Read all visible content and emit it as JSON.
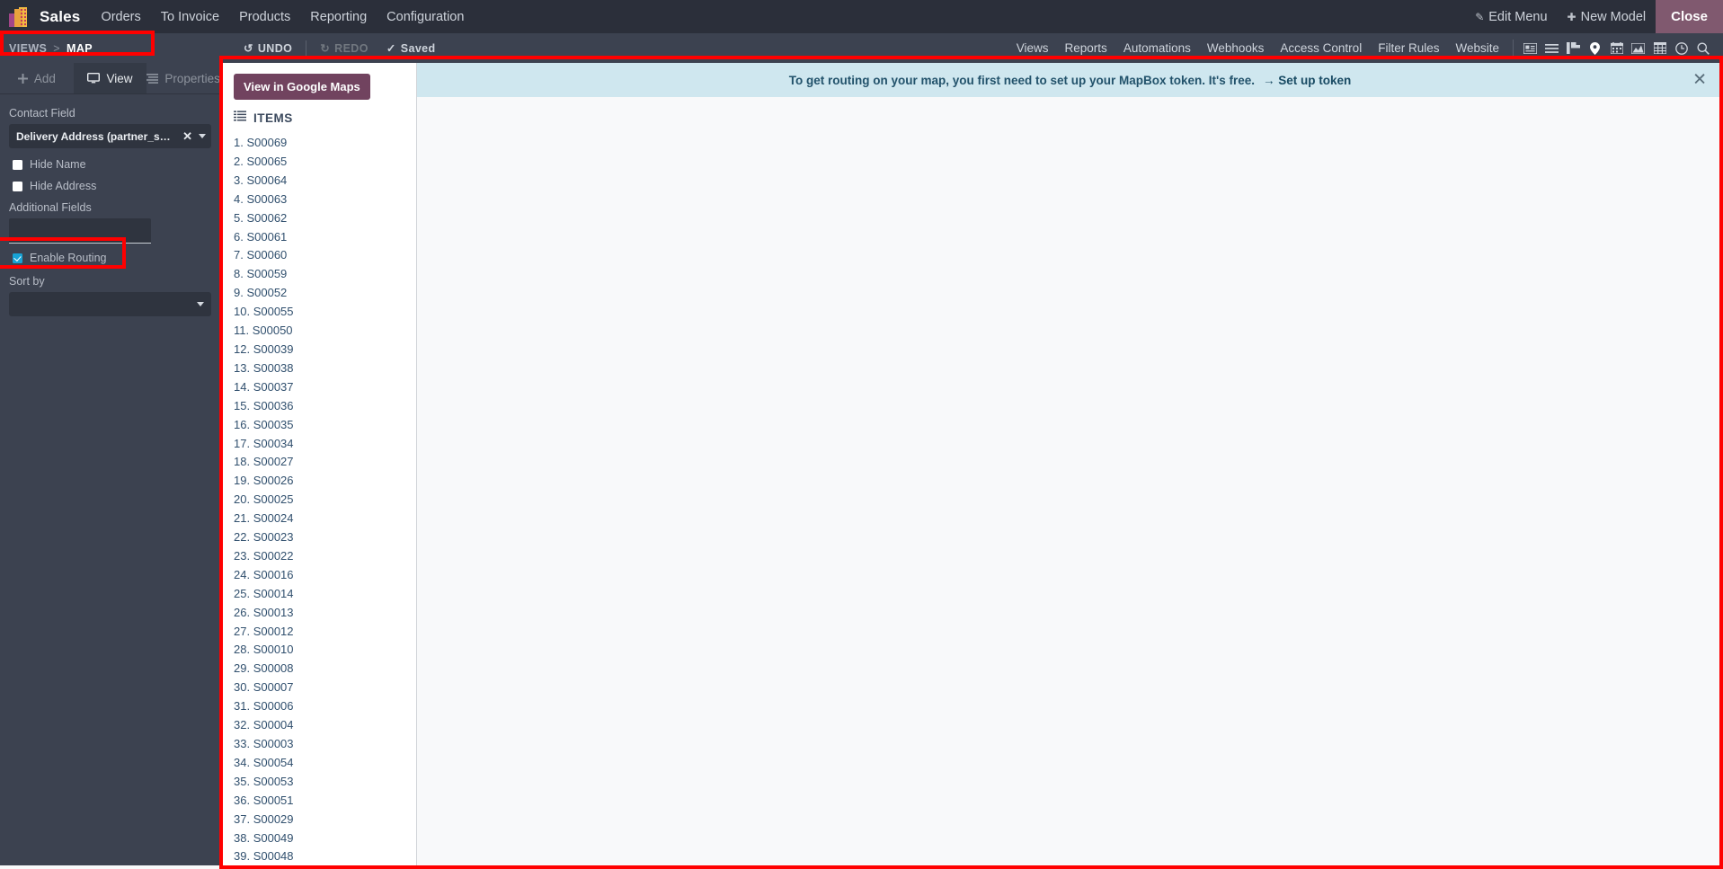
{
  "navbar": {
    "brand": "Sales",
    "logo_icon": "odoo-sales-logo-icon",
    "menu": [
      "Orders",
      "To Invoice",
      "Products",
      "Reporting",
      "Configuration"
    ],
    "edit_menu": "Edit Menu",
    "edit_menu_icon": "pencil-icon",
    "new_model": "New Model",
    "new_model_icon": "plus-icon",
    "close": "Close"
  },
  "controlpanel": {
    "breadcrumb_root": "VIEWS",
    "breadcrumb_sep": ">",
    "breadcrumb_current": "MAP",
    "undo": "UNDO",
    "undo_icon": "undo-arrow-icon",
    "redo": "REDO",
    "redo_icon": "redo-arrow-icon",
    "saved": "Saved",
    "saved_icon": "check-icon",
    "links": [
      "Views",
      "Reports",
      "Automations",
      "Webhooks",
      "Access Control",
      "Filter Rules",
      "Website"
    ],
    "view_icons": [
      "kanban-icon",
      "list-icon",
      "gantt-icon",
      "map-pin-icon",
      "calendar-icon",
      "graph-icon",
      "pivot-icon",
      "activity-clock-icon",
      "search-icon"
    ]
  },
  "sidebar": {
    "tabs": [
      {
        "label": "Add",
        "icon": "plus-icon",
        "active": false
      },
      {
        "label": "View",
        "icon": "monitor-icon",
        "active": true
      },
      {
        "label": "Properties",
        "icon": "properties-icon",
        "active": false
      }
    ],
    "contact_field_label": "Contact Field",
    "contact_field_value": "Delivery Address (partner_shipping...",
    "clear_icon": "close-x-icon",
    "dropdown_icon": "chevron-down-icon",
    "hide_name_label": "Hide Name",
    "hide_name_checked": false,
    "hide_address_label": "Hide Address",
    "hide_address_checked": false,
    "additional_fields_label": "Additional Fields",
    "additional_fields_value": "",
    "additional_fields_placeholder": "",
    "enable_routing_label": "Enable Routing",
    "enable_routing_checked": true,
    "sort_by_label": "Sort by",
    "sort_by_value": ""
  },
  "items_panel": {
    "google_maps_button": "View in Google Maps",
    "items_header": "ITEMS",
    "items_header_icon": "list-lines-icon",
    "items": [
      "S00069",
      "S00065",
      "S00064",
      "S00063",
      "S00062",
      "S00061",
      "S00060",
      "S00059",
      "S00052",
      "S00055",
      "S00050",
      "S00039",
      "S00038",
      "S00037",
      "S00036",
      "S00035",
      "S00034",
      "S00027",
      "S00026",
      "S00025",
      "S00024",
      "S00023",
      "S00022",
      "S00016",
      "S00014",
      "S00013",
      "S00012",
      "S00010",
      "S00008",
      "S00007",
      "S00006",
      "S00004",
      "S00003",
      "S00054",
      "S00053",
      "S00051",
      "S00029",
      "S00049",
      "S00048"
    ]
  },
  "map": {
    "alert_text": "To get routing on your map, you first need to set up your MapBox token. It's free.",
    "alert_link": "Set up token",
    "alert_link_icon": "arrow-right-icon",
    "alert_close_icon": "close-x-icon"
  },
  "colors": {
    "navbar_bg": "#2b2f3a",
    "controlpanel_bg": "#3c4250",
    "sidebar_bg": "#3c4250",
    "accent_purple": "#71435f",
    "close_btn_bg": "#80596f",
    "alert_bg": "#cfe7ef",
    "annotation": "#ff0000",
    "checkbox_on": "#17a2d4"
  }
}
